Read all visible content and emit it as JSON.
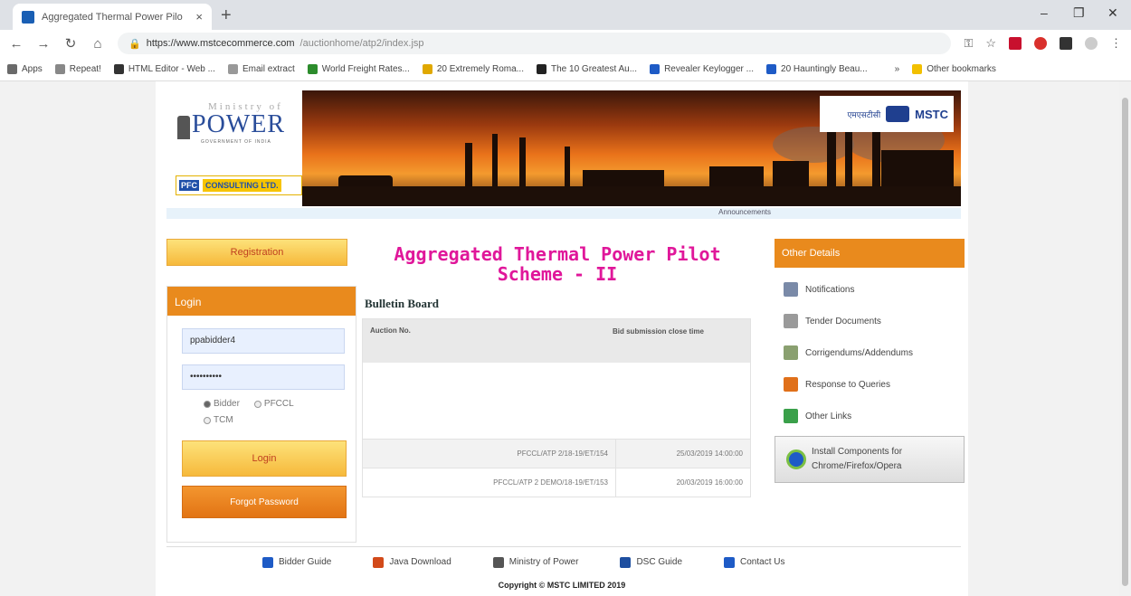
{
  "browser": {
    "tab_title": "Aggregated Thermal Power Pilo",
    "tab_close": "×",
    "new_tab": "+",
    "win_min": "–",
    "win_max": "❐",
    "win_close": "✕",
    "url_host": "https://www.mstcecommerce.com",
    "url_path": "/auctionhome/atp2/index.jsp",
    "bookmarks": [
      {
        "label": "Apps",
        "color": "#6a6a6a"
      },
      {
        "label": "Repeat!",
        "color": "#888888"
      },
      {
        "label": "HTML Editor - Web ...",
        "color": "#333333"
      },
      {
        "label": "Email extract",
        "color": "#999999"
      },
      {
        "label": "World Freight Rates...",
        "color": "#2c8c2c"
      },
      {
        "label": "20 Extremely Roma...",
        "color": "#e0a800"
      },
      {
        "label": "The 10 Greatest Au...",
        "color": "#222222"
      },
      {
        "label": "Revealer Keylogger ...",
        "color": "#1e5bc6"
      },
      {
        "label": "20 Hauntingly Beau...",
        "color": "#1e5bc6"
      },
      {
        "label": "»",
        "color": "#ffffff"
      },
      {
        "label": "Other bookmarks",
        "color": "#f2c000"
      }
    ]
  },
  "header": {
    "mop_small": "Ministry of",
    "mop_big": "POWER",
    "mop_sub": "GOVERNMENT OF INDIA",
    "pfc_badge": "PFC",
    "pfc_text": "CONSULTING LTD.",
    "mstc_hindi": "एमएसटीसी",
    "mstc_text": "MSTC",
    "announcements": "Announcements"
  },
  "left": {
    "registration": "Registration",
    "login_head": "Login",
    "username_value": "ppabidder4",
    "password_value": "••••••••••",
    "radios": [
      {
        "label": "Bidder",
        "checked": true
      },
      {
        "label": "PFCCL",
        "checked": false
      },
      {
        "label": "TCM",
        "checked": false
      }
    ],
    "login_button": "Login",
    "forgot_button": "Forgot Password"
  },
  "main": {
    "title": "Aggregated Thermal Power Pilot Scheme - II",
    "bulletin_title": "Bulletin Board",
    "col_auction": "Auction No.",
    "col_close": "Bid submission close time",
    "rows": [
      {
        "auction": "PFCCL/ATP 2/18-19/ET/154",
        "close": "25/03/2019 14:00:00"
      },
      {
        "auction": "PFCCL/ATP 2 DEMO/18-19/ET/153",
        "close": "20/03/2019 16:00:00"
      }
    ]
  },
  "right": {
    "head": "Other Details",
    "items": [
      {
        "label": "Notifications",
        "icon": "notifications-icon",
        "color": "#7a8aa8"
      },
      {
        "label": "Tender Documents",
        "icon": "document-icon",
        "color": "#9a9a9a"
      },
      {
        "label": "Corrigendums/Addendums",
        "icon": "corrigendum-icon",
        "color": "#8aa070"
      },
      {
        "label": "Response to Queries",
        "icon": "chat-icon",
        "color": "#e0701a"
      },
      {
        "label": "Other Links",
        "icon": "globe-icon",
        "color": "#3aa04a"
      }
    ],
    "install_line1": "Install Components for",
    "install_line2": "Chrome/Firefox/Opera"
  },
  "footer": {
    "items": [
      {
        "label": "Bidder Guide",
        "color": "#1e5bc6"
      },
      {
        "label": "Java Download",
        "color": "#d24a1a"
      },
      {
        "label": "Ministry of Power",
        "color": "#555555"
      },
      {
        "label": "DSC Guide",
        "color": "#1e4fa0"
      },
      {
        "label": "Contact Us",
        "color": "#1e5bc6"
      }
    ],
    "copyright": "Copyright © MSTC LIMITED 2019"
  }
}
